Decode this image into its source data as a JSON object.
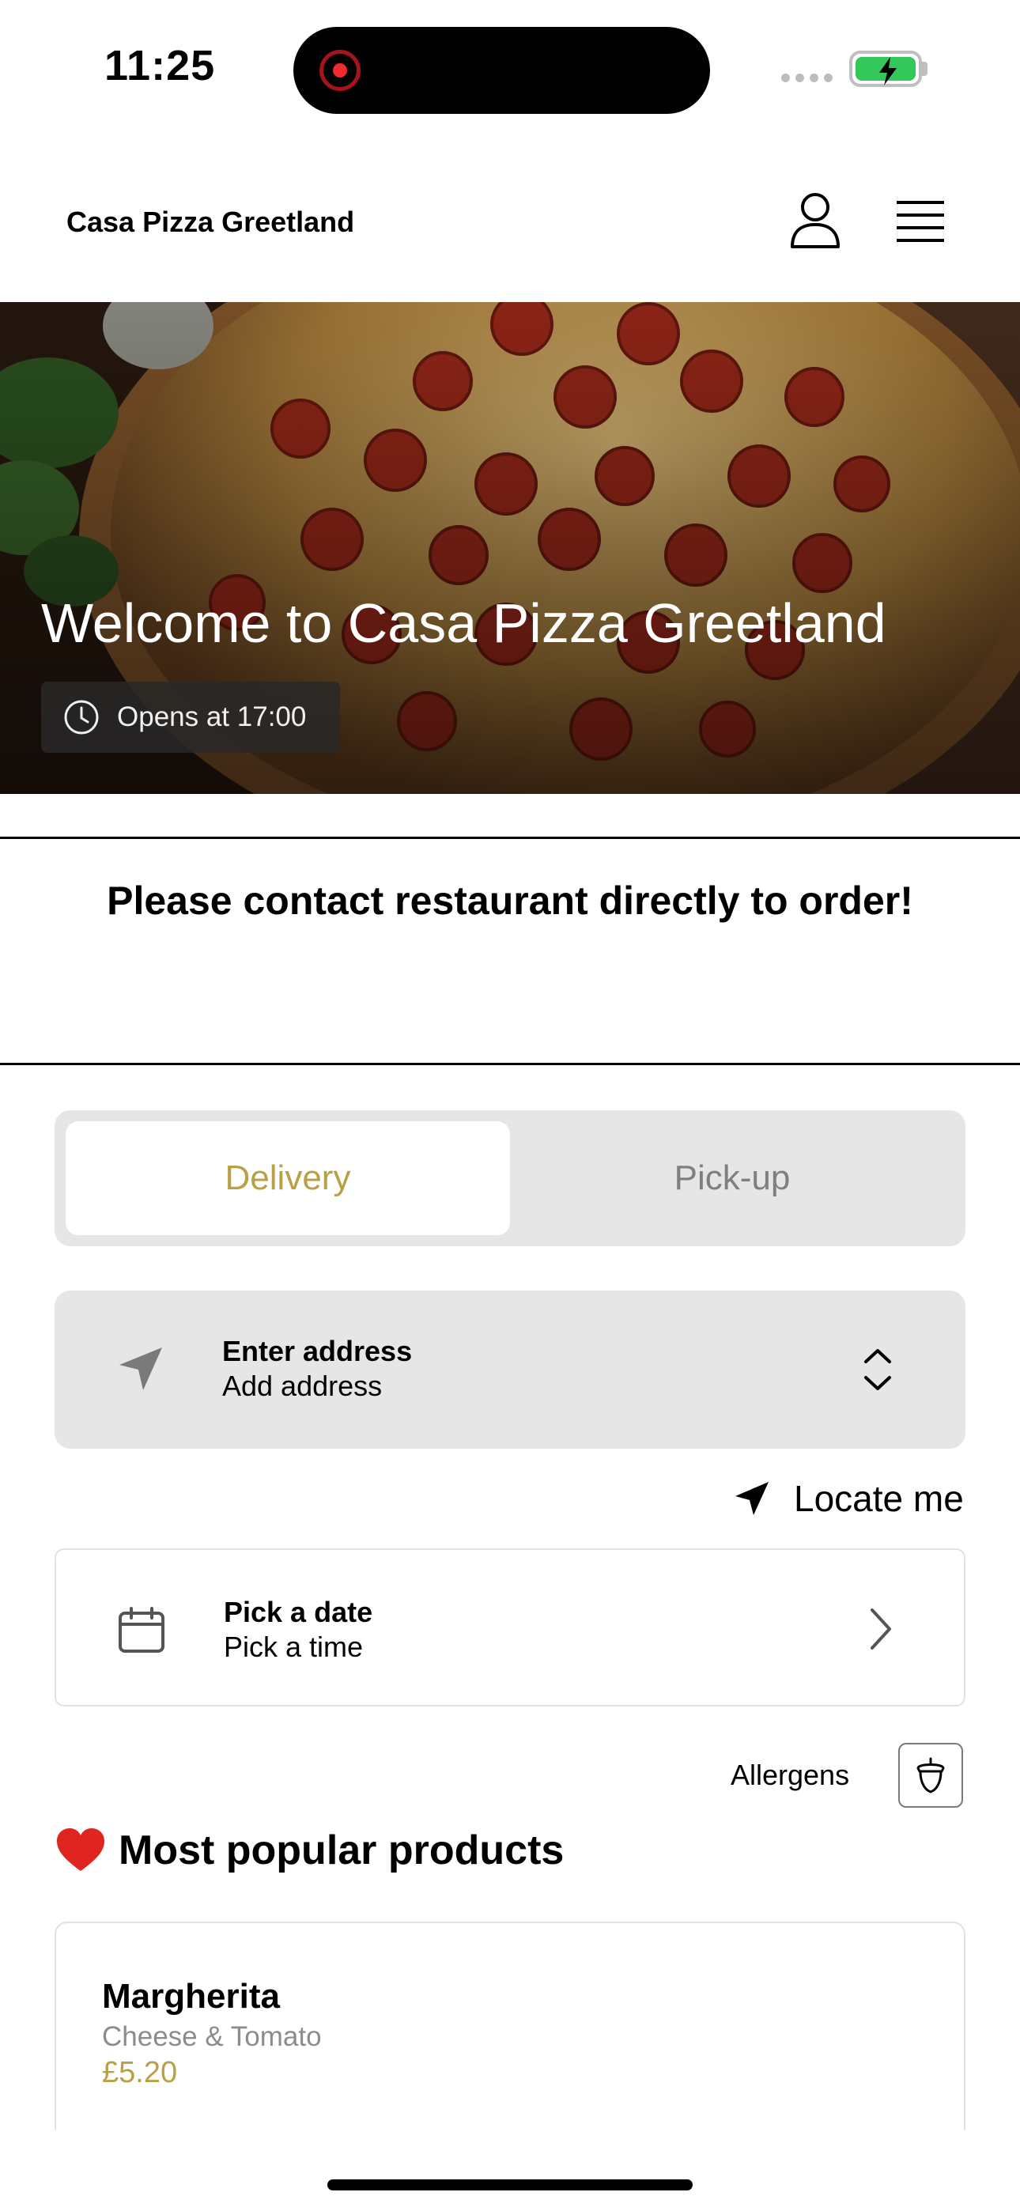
{
  "status_bar": {
    "time": "11:25"
  },
  "header": {
    "brand": "Casa Pizza Greetland"
  },
  "icons": {
    "user": "user-icon",
    "menu": "hamburger-menu-icon",
    "clock": "clock-icon",
    "location": "location-arrow-icon",
    "chevrons": "chevron-up-down-icon",
    "calendar": "calendar-icon",
    "chevron_right": "chevron-right-icon",
    "allergens": "acorn-icon",
    "heart": "heart-icon"
  },
  "hero": {
    "title": "Welcome to Casa Pizza Greetland",
    "opens": "Opens at 17:00"
  },
  "notice": {
    "text": "Please contact restaurant directly to order!"
  },
  "tabs": [
    {
      "label": "Delivery",
      "active": true
    },
    {
      "label": "Pick-up",
      "active": false
    }
  ],
  "address": {
    "title": "Enter address",
    "placeholder": "Add address"
  },
  "locate": {
    "label": "Locate me"
  },
  "schedule": {
    "date_label": "Pick a date",
    "time_label": "Pick a time"
  },
  "allergens": {
    "label": "Allergens"
  },
  "popular": {
    "emoji": "❤️",
    "heading": "Most popular products",
    "products": [
      {
        "name": "Margherita",
        "description": "Cheese & Tomato",
        "price": "£5.20"
      }
    ]
  },
  "colors": {
    "accent": "#b9a047",
    "tab_bg": "#e6e6e6",
    "battery": "#34c759",
    "record": "#ef2b2f"
  }
}
